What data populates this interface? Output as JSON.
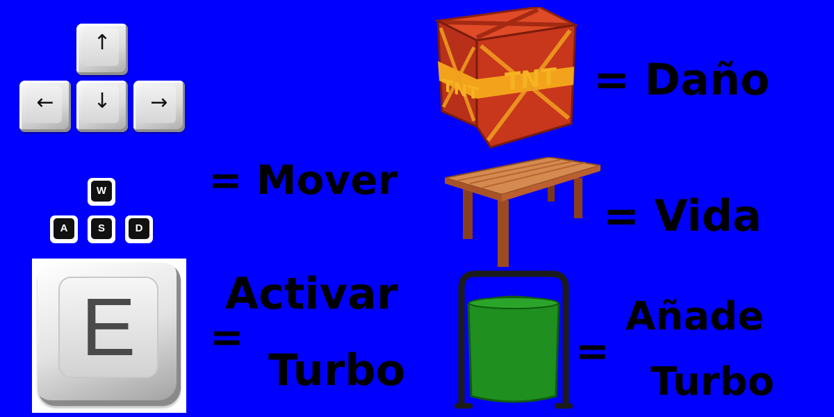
{
  "arrow_keys": {
    "up": "↑",
    "left": "←",
    "down": "↓",
    "right": "→"
  },
  "wasd_keys": {
    "w": "W",
    "a": "A",
    "s": "S",
    "d": "D"
  },
  "e_key": {
    "letter": "E"
  },
  "labels": {
    "damage": "= Daño",
    "move": "= Mover",
    "life": "= Vida",
    "activate_eq": "=",
    "activate_line1": "Activar",
    "activate_line2": "Turbo",
    "add_eq": "=",
    "add_line1": "Añade",
    "add_line2": "Turbo"
  },
  "colors": {
    "background": "#0000ff",
    "crate_red": "#c8361b",
    "crate_band": "#f2a31b",
    "table_wood": "#b8612e",
    "bin_green": "#1f8f1f",
    "bin_frame": "#222222"
  },
  "icons": [
    "arrow-keys-icon",
    "wasd-keys-icon",
    "e-key-icon",
    "tnt-crate-icon",
    "wooden-table-icon",
    "trash-bin-icon"
  ]
}
